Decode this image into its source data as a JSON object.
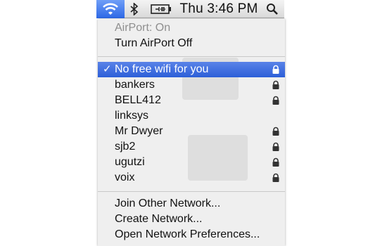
{
  "menubar": {
    "clock": "Thu 3:46 PM",
    "icons": [
      "wifi-icon",
      "bluetooth-icon",
      "battery-icon",
      "spotlight-search-icon"
    ]
  },
  "menu": {
    "status": "AirPort: On",
    "toggle": "Turn AirPort Off",
    "networks": [
      {
        "name": "No free wifi for you",
        "locked": true,
        "selected": true
      },
      {
        "name": "bankers",
        "locked": true,
        "selected": false
      },
      {
        "name": "BELL412",
        "locked": true,
        "selected": false
      },
      {
        "name": "linksys",
        "locked": false,
        "selected": false
      },
      {
        "name": "Mr Dwyer",
        "locked": true,
        "selected": false
      },
      {
        "name": "sjb2",
        "locked": true,
        "selected": false
      },
      {
        "name": "ugutzi",
        "locked": true,
        "selected": false
      },
      {
        "name": "voix",
        "locked": true,
        "selected": false
      }
    ],
    "actions": {
      "join": "Join Other Network...",
      "create": "Create Network...",
      "preferences": "Open Network Preferences..."
    }
  },
  "colors": {
    "highlight": "#2c5fd8",
    "wifi_active": "#3a73ec"
  }
}
